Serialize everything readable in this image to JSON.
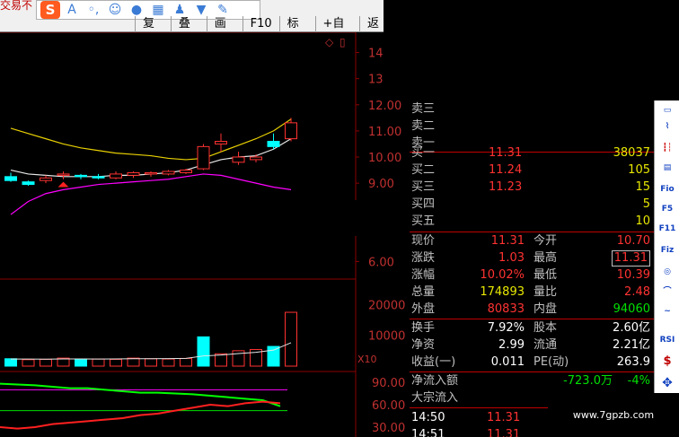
{
  "app": {
    "title_fragment": "交易不"
  },
  "ime_toolbar": {
    "icons": [
      "sogou-logo",
      "english-mode-icon",
      "punctuation-icon",
      "emoji-icon",
      "voice-icon",
      "keyboard-icon",
      "user-icon",
      "skin-icon",
      "tools-icon"
    ],
    "logo_text": "S",
    "mode_text": "A"
  },
  "toolbar": {
    "buttons": [
      "复权",
      "叠加",
      "画线",
      "F10",
      "标记",
      "+自选",
      "返"
    ]
  },
  "chart": {
    "price_axis": [
      "14.",
      "13.",
      "12.00",
      "11.00",
      "10.00",
      "9.00",
      "6.00"
    ],
    "volume_axis": [
      "20000",
      "10000"
    ],
    "volume_unit": "X10",
    "indicator_axis": [
      "90.00",
      "60.00",
      "30.00"
    ],
    "colors": {
      "up": "#ff3232",
      "down": "#00ffff",
      "ma5": "#e8e8e8",
      "ma10": "#e8d000",
      "ma20": "#ff00ff",
      "grid": "#8b0000"
    }
  },
  "chart_data": {
    "type": "candlestick",
    "candles": [
      {
        "o": 9.25,
        "h": 9.4,
        "l": 9.05,
        "c": 9.1
      },
      {
        "o": 9.05,
        "h": 9.1,
        "l": 8.9,
        "c": 8.95
      },
      {
        "o": 9.1,
        "h": 9.3,
        "l": 9.0,
        "c": 9.2
      },
      {
        "o": 9.3,
        "h": 9.45,
        "l": 9.15,
        "c": 9.35
      },
      {
        "o": 9.3,
        "h": 9.35,
        "l": 9.15,
        "c": 9.25
      },
      {
        "o": 9.25,
        "h": 9.35,
        "l": 9.15,
        "c": 9.2
      },
      {
        "o": 9.2,
        "h": 9.45,
        "l": 9.15,
        "c": 9.35
      },
      {
        "o": 9.3,
        "h": 9.45,
        "l": 9.2,
        "c": 9.4
      },
      {
        "o": 9.35,
        "h": 9.45,
        "l": 9.25,
        "c": 9.4
      },
      {
        "o": 9.35,
        "h": 9.5,
        "l": 9.3,
        "c": 9.45
      },
      {
        "o": 9.4,
        "h": 9.55,
        "l": 9.35,
        "c": 9.5
      },
      {
        "o": 9.55,
        "h": 10.5,
        "l": 9.5,
        "c": 10.4
      },
      {
        "o": 10.5,
        "h": 10.9,
        "l": 10.2,
        "c": 10.6
      },
      {
        "o": 9.8,
        "h": 10.2,
        "l": 9.7,
        "c": 10.0
      },
      {
        "o": 9.9,
        "h": 10.1,
        "l": 9.8,
        "c": 10.0
      },
      {
        "o": 10.6,
        "h": 10.9,
        "l": 10.3,
        "c": 10.4
      },
      {
        "o": 10.7,
        "h": 11.5,
        "l": 10.6,
        "c": 11.31
      }
    ],
    "volume": [
      {
        "v": 2400,
        "up": false
      },
      {
        "v": 2100,
        "up": true
      },
      {
        "v": 2200,
        "up": true
      },
      {
        "v": 2600,
        "up": true
      },
      {
        "v": 2300,
        "up": false
      },
      {
        "v": 2300,
        "up": true
      },
      {
        "v": 2200,
        "up": true
      },
      {
        "v": 2600,
        "up": true
      },
      {
        "v": 2400,
        "up": true
      },
      {
        "v": 2300,
        "up": true
      },
      {
        "v": 2500,
        "up": true
      },
      {
        "v": 9500,
        "up": false
      },
      {
        "v": 4000,
        "up": true
      },
      {
        "v": 5000,
        "up": true
      },
      {
        "v": 5400,
        "up": true
      },
      {
        "v": 6400,
        "up": false
      },
      {
        "v": 17489,
        "up": true
      }
    ],
    "ma10": [
      11.1,
      10.9,
      10.7,
      10.5,
      10.35,
      10.25,
      10.15,
      10.1,
      10.05,
      9.95,
      9.9,
      9.95,
      10.2,
      10.45,
      10.7,
      11.0,
      11.45
    ],
    "ma20": [
      7.8,
      8.3,
      8.6,
      8.75,
      8.85,
      8.95,
      9.0,
      9.05,
      9.1,
      9.15,
      9.25,
      9.35,
      9.3,
      9.15,
      9.0,
      8.85,
      8.75
    ],
    "ma5": [
      9.5,
      9.35,
      9.3,
      9.25,
      9.25,
      9.25,
      9.3,
      9.3,
      9.35,
      9.4,
      9.5,
      9.7,
      9.9,
      10.0,
      10.05,
      10.3,
      10.7
    ]
  },
  "quote": {
    "sell": [
      {
        "label": "卖三",
        "price": "",
        "vol": ""
      },
      {
        "label": "卖二",
        "price": "",
        "vol": ""
      },
      {
        "label": "卖一",
        "price": "",
        "vol": ""
      }
    ],
    "buy": [
      {
        "label": "买一",
        "price": "11.31",
        "vol": "38037"
      },
      {
        "label": "买二",
        "price": "11.24",
        "vol": "105"
      },
      {
        "label": "买三",
        "price": "11.23",
        "vol": "15"
      },
      {
        "label": "买四",
        "price": "",
        "vol": "5"
      },
      {
        "label": "买五",
        "price": "",
        "vol": "10"
      }
    ],
    "stats": [
      {
        "l1": "现价",
        "v1": "11.31",
        "l2": "今开",
        "v2": "10.70"
      },
      {
        "l1": "涨跌",
        "v1": "1.03",
        "l2": "最高",
        "v2": "11.31"
      },
      {
        "l1": "涨幅",
        "v1": "10.02%",
        "l2": "最低",
        "v2": "10.39"
      },
      {
        "l1": "总量",
        "v1": "174893",
        "l2": "量比",
        "v2": "2.48"
      },
      {
        "l1": "外盘",
        "v1": "80833",
        "l2": "内盘",
        "v2": "94060"
      }
    ],
    "fund": [
      {
        "l1": "换手",
        "v1": "7.92%",
        "l2": "股本",
        "v2": "2.60亿"
      },
      {
        "l1": "净资",
        "v1": "2.99",
        "l2": "流通",
        "v2": "2.21亿"
      },
      {
        "l1": "收益(一)",
        "v1": "0.011",
        "l2": "PE(动)",
        "v2": "263.9"
      }
    ],
    "flow": {
      "net_label": "净流入额",
      "net_value": "-723.0万",
      "net_pct": "-4%",
      "block_label": "大宗流入"
    },
    "ticks": [
      {
        "time": "14:50",
        "price": "11.31"
      },
      {
        "time": "14:51",
        "price": "11.31"
      }
    ]
  },
  "right_toolbar": {
    "buttons": [
      "chart",
      "line-icon",
      "kline-icon",
      "table-icon",
      "F10",
      "F5",
      "F11",
      "F12",
      "macd-icon",
      "Fiz",
      "RSI",
      "S",
      "move"
    ],
    "labels": [
      "",
      "",
      "",
      "",
      "Fio",
      "F5",
      "F11",
      "Fiz",
      "",
      "",
      "RSI",
      "$",
      "✥"
    ]
  },
  "watermark": {
    "text": "www.7gpzb.com"
  }
}
